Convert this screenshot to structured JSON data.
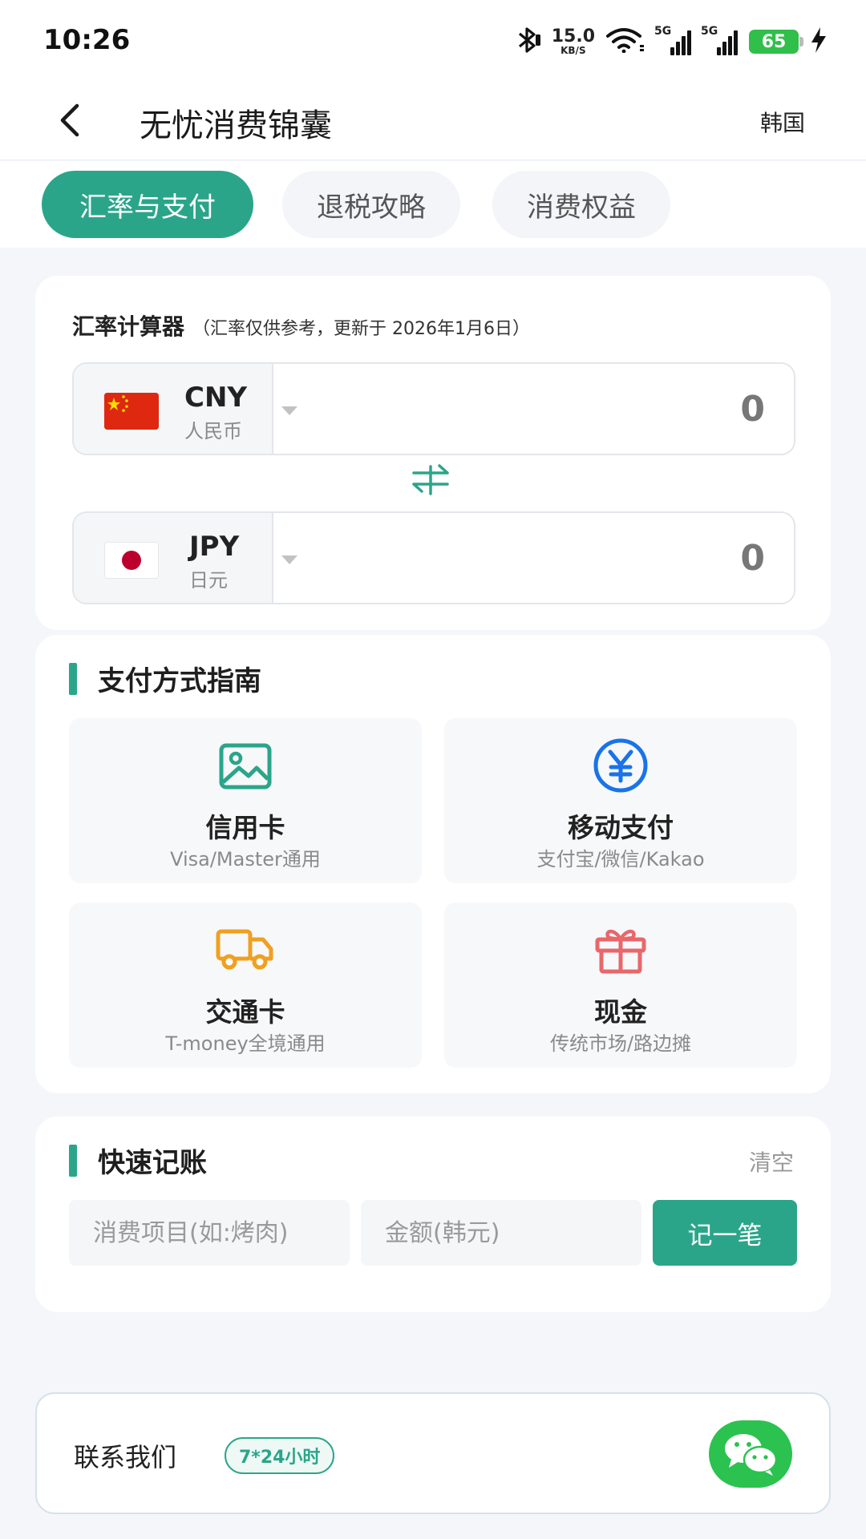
{
  "status_bar": {
    "time": "10:26",
    "net_speed": "15.0",
    "net_speed_unit": "KB/S",
    "sim1_label": "5G",
    "sim2_label": "5G",
    "battery": "65",
    "icons": [
      "bluetooth-icon",
      "wifi-icon",
      "signal-icon",
      "charging-icon"
    ]
  },
  "header": {
    "title": "无忧消费锦囊",
    "region": "韩国"
  },
  "tabs": [
    {
      "label": "汇率与支付",
      "active": true
    },
    {
      "label": "退税攻略",
      "active": false
    },
    {
      "label": "消费权益",
      "active": false
    }
  ],
  "calculator": {
    "title": "汇率计算器",
    "note": "（汇率仅供参考，更新于 2026年1月6日）",
    "from": {
      "code": "CNY",
      "name": "人民币",
      "amount": "0"
    },
    "to": {
      "code": "JPY",
      "name": "日元",
      "amount": "0"
    }
  },
  "payment": {
    "title": "支付方式指南",
    "methods": [
      {
        "name": "信用卡",
        "desc": "Visa/Master通用",
        "icon": "image-icon"
      },
      {
        "name": "移动支付",
        "desc": "支付宝/微信/Kakao",
        "icon": "yuan-icon"
      },
      {
        "name": "交通卡",
        "desc": "T-money全境通用",
        "icon": "truck-icon"
      },
      {
        "name": "现金",
        "desc": "传统市场/路边摊",
        "icon": "gift-icon"
      }
    ]
  },
  "ledger": {
    "title": "快速记账",
    "clear_label": "清空",
    "item_placeholder": "消费项目(如:烤肉)",
    "amount_placeholder": "金额(韩元)",
    "record_label": "记一笔"
  },
  "contact": {
    "label": "联系我们",
    "hours": "7*24小时",
    "icon": "wechat-icon"
  },
  "colors": {
    "accent": "#2ba58a",
    "background": "#f4f6fa",
    "wechat": "#2bc250"
  }
}
